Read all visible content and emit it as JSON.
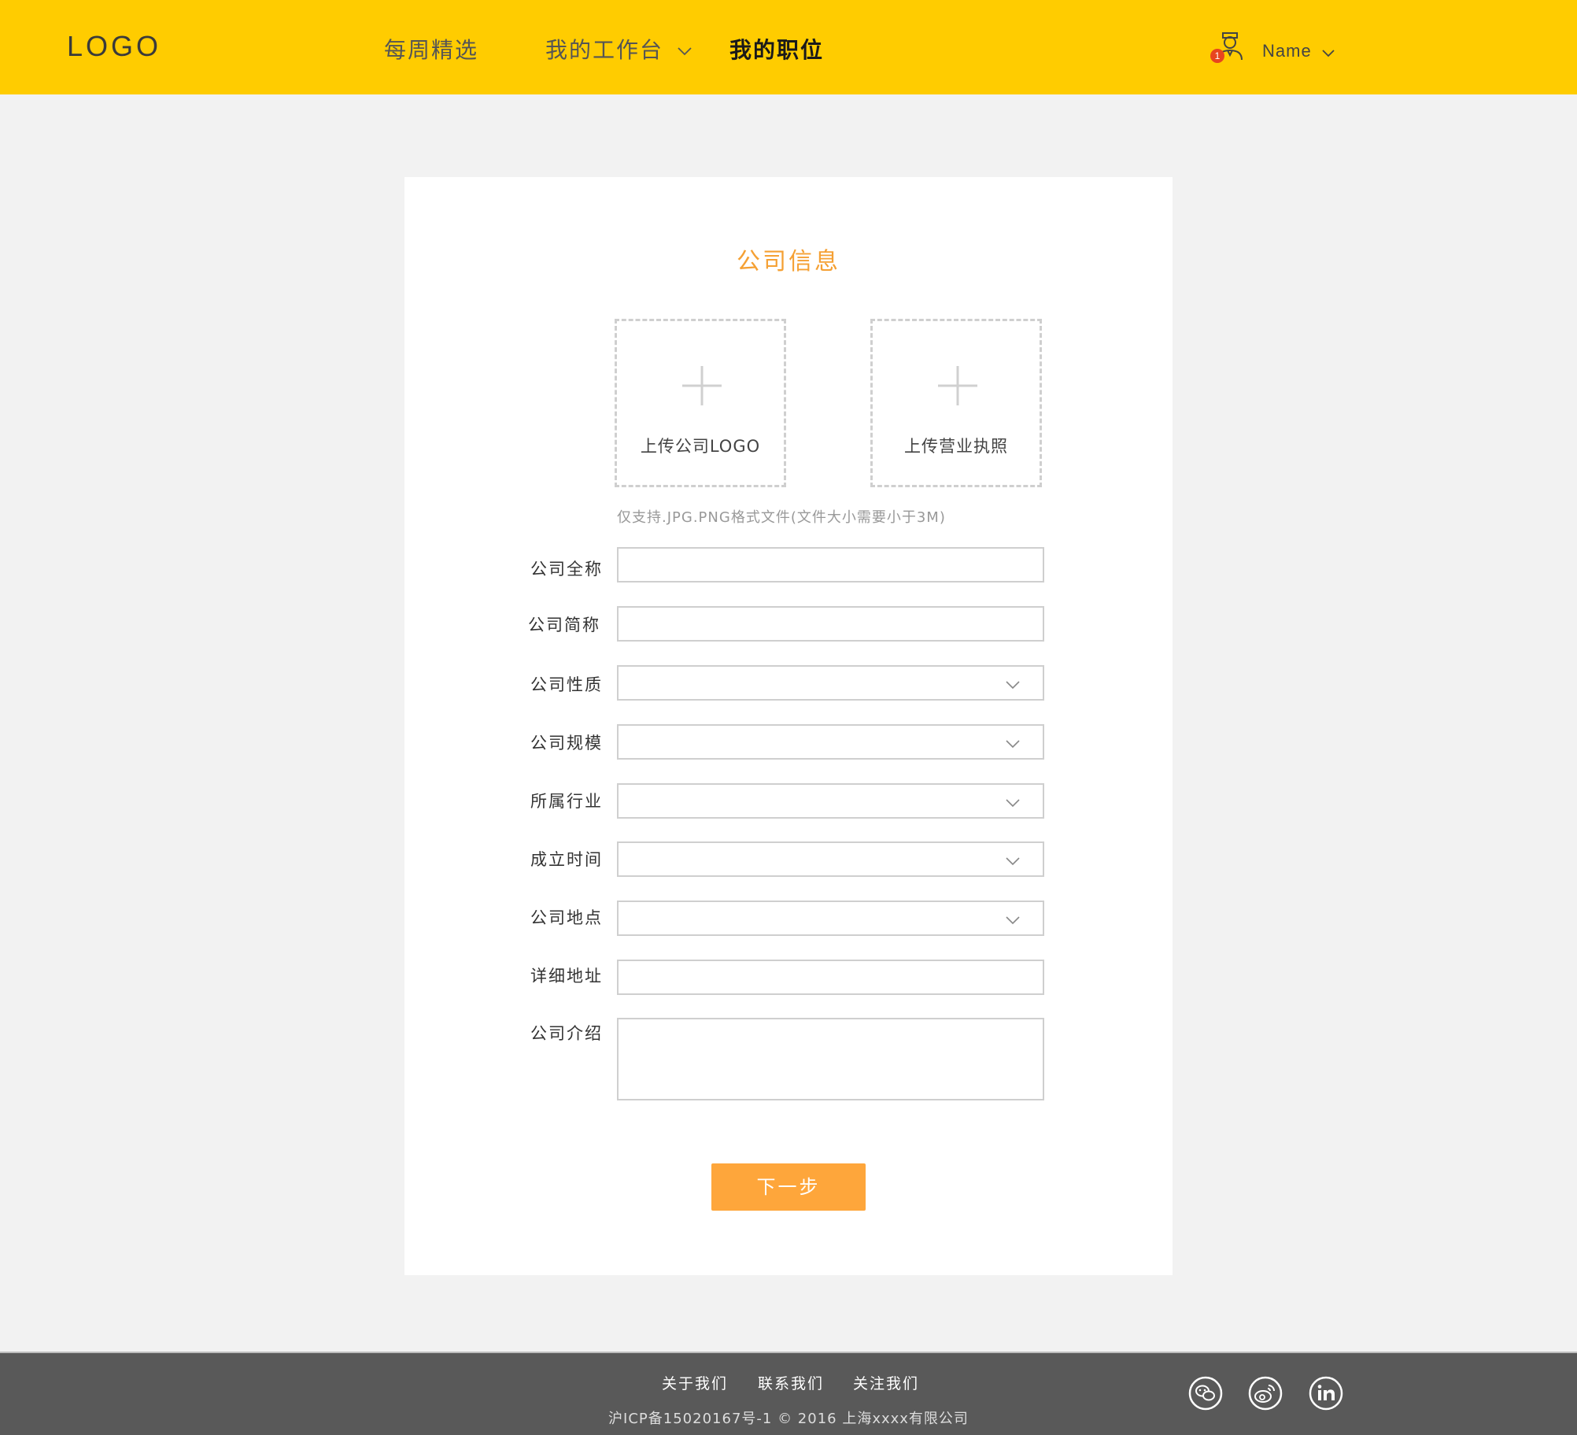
{
  "header": {
    "logo": "LOGO",
    "nav": [
      {
        "label": "每周精选",
        "active": false
      },
      {
        "label": "我的工作台",
        "active": false,
        "has_dropdown": true
      },
      {
        "label": "我的职位",
        "active": true
      }
    ],
    "user": {
      "name": "Name",
      "badge_count": "1"
    }
  },
  "form": {
    "title": "公司信息",
    "uploads": [
      {
        "label": "上传公司LOGO"
      },
      {
        "label": "上传营业执照"
      }
    ],
    "upload_hint": "仅支持.JPG.PNG格式文件(文件大小需要小于3M)",
    "fields": [
      {
        "label": "公司全称",
        "type": "text",
        "value": ""
      },
      {
        "label": "公司简称",
        "type": "text",
        "value": ""
      },
      {
        "label": "公司性质",
        "type": "select",
        "value": ""
      },
      {
        "label": "公司规模",
        "type": "select",
        "value": ""
      },
      {
        "label": "所属行业",
        "type": "select",
        "value": ""
      },
      {
        "label": "成立时间",
        "type": "select",
        "value": ""
      },
      {
        "label": "公司地点",
        "type": "select",
        "value": ""
      },
      {
        "label": "详细地址",
        "type": "text",
        "value": ""
      },
      {
        "label": "公司介绍",
        "type": "textarea",
        "value": ""
      }
    ],
    "next_button": "下一步"
  },
  "footer": {
    "links": [
      "关于我们",
      "联系我们",
      "关注我们"
    ],
    "copyright": "沪ICP备15020167号-1 © 2016 上海xxxx有限公司",
    "social_icons": [
      "wechat-icon",
      "weibo-icon",
      "linkedin-icon"
    ]
  },
  "colors": {
    "header_bg": "#ffcc00",
    "accent": "#fea63b",
    "title": "#f5a033",
    "footer_bg": "#595959",
    "badge": "#e8441f"
  }
}
